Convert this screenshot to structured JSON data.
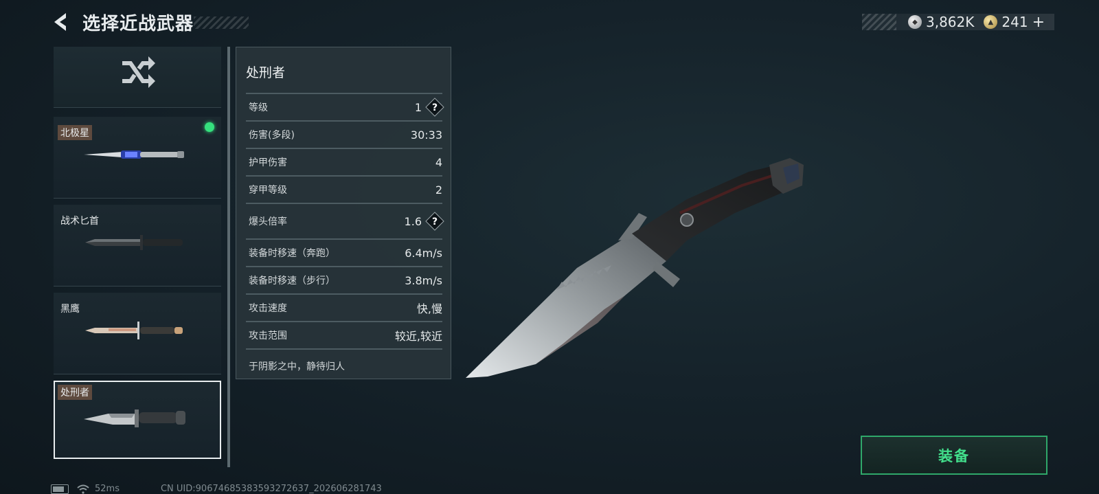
{
  "header": {
    "title": "选择近战武器",
    "currency": [
      {
        "icon": "silver-coin-icon",
        "value": "3,862K"
      },
      {
        "icon": "gold-coin-icon",
        "value": "241",
        "plus": "+"
      }
    ]
  },
  "weapon_list": {
    "shuffle_icon": "shuffle-icon",
    "items": [
      {
        "name": "北极星",
        "equipped": true,
        "selected": false
      },
      {
        "name": "战术匕首",
        "equipped": false,
        "selected": false
      },
      {
        "name": "黑鹰",
        "equipped": false,
        "selected": false
      },
      {
        "name": "处刑者",
        "equipped": false,
        "selected": true
      }
    ]
  },
  "details": {
    "name": "处刑者",
    "stats": [
      {
        "label": "等级",
        "value": "1",
        "help": true
      },
      {
        "label": "伤害(多段)",
        "value": "30:33"
      },
      {
        "label": "护甲伤害",
        "value": "4"
      },
      {
        "label": "穿甲等级",
        "value": "2"
      },
      {
        "label": "爆头倍率",
        "value": "1.6",
        "help": true
      },
      {
        "label": "装备时移速（奔跑）",
        "value": "6.4m/s"
      },
      {
        "label": "装备时移速（步行）",
        "value": "3.8m/s"
      },
      {
        "label": "攻击速度",
        "value": "快,慢"
      },
      {
        "label": "攻击范围",
        "value": "较近,较近"
      }
    ],
    "description": "于阴影之中，静待归人"
  },
  "equip_button": {
    "label": "装备"
  },
  "status_bar": {
    "ping": "52ms",
    "uid": "CN UID:906746853835932726​37_202606281743"
  },
  "colors": {
    "accent_green": "#42e08c",
    "equipped_dot": "#35e07d",
    "tag_bg": "#5e4a3e"
  }
}
